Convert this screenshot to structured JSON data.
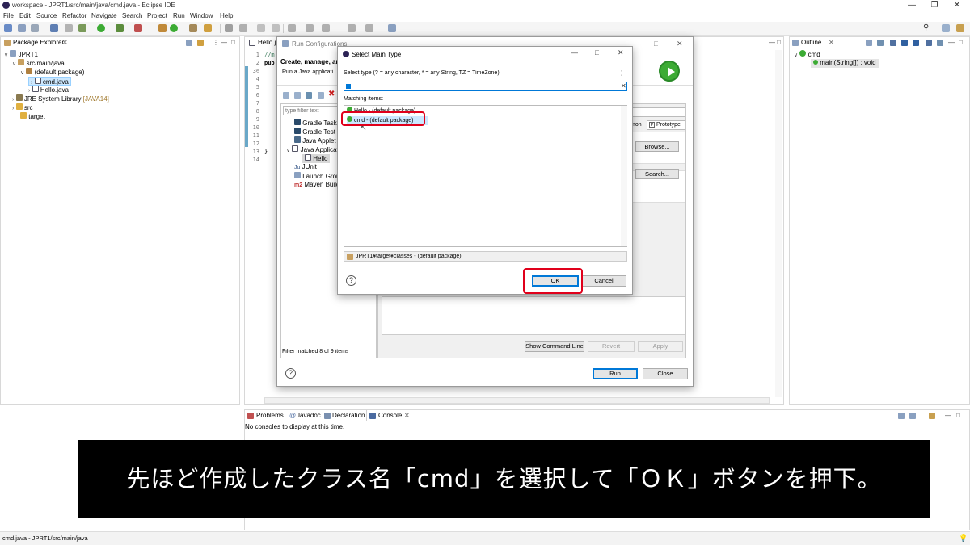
{
  "window": {
    "title": "workspace - JPRT1/src/main/java/cmd.java - Eclipse IDE"
  },
  "menu": [
    "File",
    "Edit",
    "Source",
    "Refactor",
    "Navigate",
    "Search",
    "Project",
    "Run",
    "Window",
    "Help"
  ],
  "package_explorer": {
    "tab_label": "Package Explorer",
    "items": [
      {
        "label": "JPRT1",
        "extra": ""
      },
      {
        "label": "src/main/java",
        "extra": ""
      },
      {
        "label": "(default package)",
        "extra": ""
      },
      {
        "label": "cmd.java",
        "extra": ""
      },
      {
        "label": "Hello.java",
        "extra": ""
      },
      {
        "label": "JRE System Library",
        "extra": "[JAVA14]"
      },
      {
        "label": "src",
        "extra": ""
      },
      {
        "label": "target",
        "extra": ""
      }
    ]
  },
  "editor": {
    "tab_label": "Hello.ja",
    "line_numbers": [
      "1",
      "2",
      "3⊖",
      "4",
      "5",
      "6",
      "7",
      "8",
      "9",
      "10",
      "11",
      "12",
      "13",
      "14"
    ],
    "code_lines": [
      "//m",
      "pub",
      "",
      "",
      "",
      "",
      "",
      "",
      "",
      "",
      "",
      "",
      "}",
      ""
    ]
  },
  "outline": {
    "tab_label": "Outline",
    "items": [
      {
        "label": "cmd"
      },
      {
        "label": "main(String[]) : void"
      }
    ]
  },
  "run_config": {
    "title": "Run Configurations",
    "heading": "Create, manage, an",
    "subheading": "Run a Java applicati",
    "filter_placeholder": "type filter text",
    "tree": [
      "Gradle Task",
      "Gradle Test",
      "Java Applet",
      "Java Applicati",
      "Hello",
      "JUnit",
      "Launch Grou",
      "Maven Build"
    ],
    "filter_status": "Filter matched 8 of 9 items",
    "tab_mon": "mon",
    "tab_prototype": "Prototype",
    "browse_label": "Browse...",
    "search_label": "Search...",
    "show_cmd_label": "Show Command Line",
    "revert_label": "Revert",
    "apply_label": "Apply",
    "run_label": "Run",
    "close_label": "Close"
  },
  "select_main": {
    "title": "Select Main Type",
    "prompt": "Select type (? = any character, * = any String, TZ = TimeZone):",
    "input_value": "",
    "matching_label": "Matching items:",
    "items": [
      {
        "label": "Hello - (default package)"
      },
      {
        "label": "cmd - (default package)"
      }
    ],
    "qualifier": "JPRT1¥target¥classes - (default package)",
    "ok_label": "OK",
    "cancel_label": "Cancel"
  },
  "console": {
    "tabs": [
      "Problems",
      "Javadoc",
      "Declaration",
      "Console"
    ],
    "message": "No consoles to display at this time."
  },
  "subtitle": "先ほど作成したクラス名「cmd」を選択して「ＯＫ」ボタンを押下。",
  "status": "cmd.java - JPRT1/src/main/java",
  "colors": {
    "highlight": "#e0001b",
    "selection": "#cce8ff",
    "run_green": "#3cab34"
  }
}
